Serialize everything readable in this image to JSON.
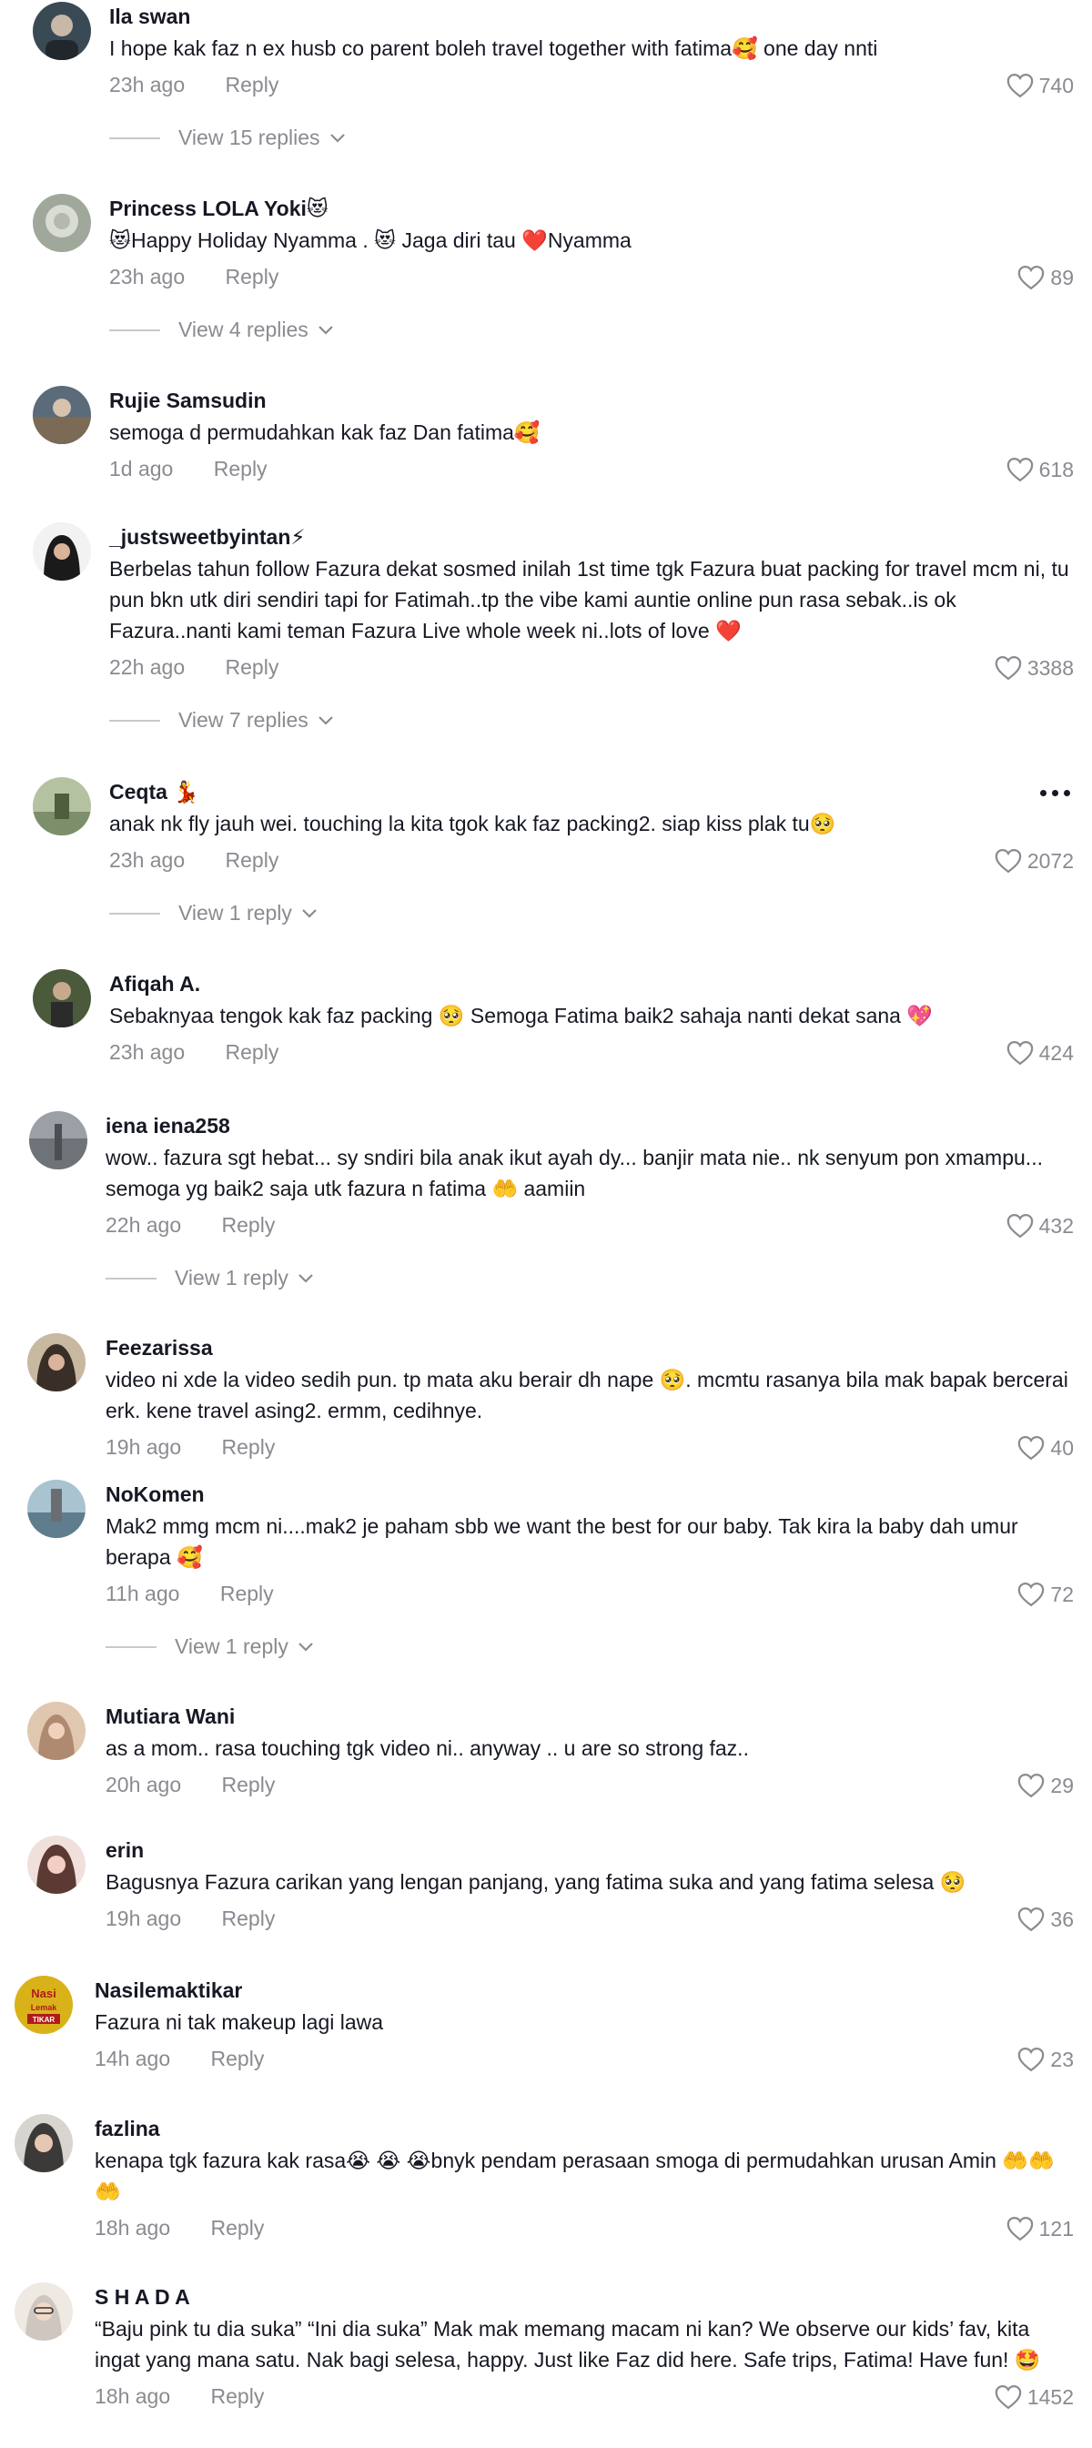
{
  "reply_label": "Reply",
  "comments": [
    {
      "username": "Ila swan",
      "text": "I hope kak faz n ex husb co parent boleh travel together with fatima🥰 one day nnti",
      "time": "23h ago",
      "likes": "740",
      "replies": "View 15 replies",
      "avatar_color": "#3a4a55"
    },
    {
      "username": "Princess LOLA Yoki😻",
      "text": "😻Happy Holiday Nyamma . 😻 Jaga diri tau ❤️Nyamma",
      "time": "23h ago",
      "likes": "89",
      "replies": "View 4 replies",
      "avatar_color": "#9fa89a"
    },
    {
      "username": "Rujie Samsudin",
      "text": "semoga d permudahkan kak faz Dan fatima🥰",
      "time": "1d ago",
      "likes": "618",
      "replies": "",
      "avatar_color": "#5b6b7a"
    },
    {
      "username": "_justsweetbyintan⚡",
      "text": "Berbelas tahun follow Fazura dekat sosmed inilah 1st time tgk Fazura buat packing for travel mcm ni, tu pun bkn utk diri sendiri tapi for Fatimah..tp the vibe kami auntie online pun rasa sebak..is ok Fazura..nanti kami teman Fazura Live whole week ni..lots of love ❤️",
      "time": "22h ago",
      "likes": "3388",
      "replies": "View 7 replies",
      "avatar_color": "#1a1a1a"
    },
    {
      "username": "Ceqta 💃",
      "text": "anak nk fly jauh wei. touching la kita tgok kak faz packing2. siap kiss plak tu🥺",
      "time": "23h ago",
      "likes": "2072",
      "replies": "View 1 reply",
      "avatar_color": "#7d8f6a"
    },
    {
      "username": "Afiqah A.",
      "text": "Sebaknyaa tengok kak faz packing 🥺 Semoga Fatima baik2 sahaja nanti dekat sana 💖",
      "time": "23h ago",
      "likes": "424",
      "replies": "",
      "avatar_color": "#4a5a3a"
    },
    {
      "username": "iena iena258",
      "text": "wow.. fazura sgt hebat... sy sndiri bila anak ikut ayah dy... banjir mata nie.. nk senyum pon xmampu... semoga yg baik2 saja utk fazura n fatima 🤲 aamiin",
      "time": "22h ago",
      "likes": "432",
      "replies": "View 1 reply",
      "avatar_color": "#6e7378"
    },
    {
      "username": "Feezarissa",
      "text": "video ni xde la video sedih pun. tp mata aku berair dh nape 🥺. mcmtu rasanya bila mak bapak bercerai erk. kene travel asing2. ermm, cedihnye.",
      "time": "19h ago",
      "likes": "40",
      "replies": "",
      "avatar_color": "#8a6e55"
    },
    {
      "username": "NoKomen",
      "text": "Mak2 mmg mcm ni....mak2 je paham sbb we want the best for our baby. Tak kira la baby dah umur berapa 🥰",
      "time": "11h ago",
      "likes": "72",
      "replies": "View 1 reply",
      "avatar_color": "#5f7d8c"
    },
    {
      "username": "Mutiara Wani",
      "text": "as a mom.. rasa touching tgk video ni.. anyway .. u are so strong faz..",
      "time": "20h ago",
      "likes": "29",
      "replies": "",
      "avatar_color": "#b08a70"
    },
    {
      "username": "erin",
      "text": "Bagusnya Fazura carikan yang lengan panjang, yang fatima suka and yang fatima selesa 🥺",
      "time": "19h ago",
      "likes": "36",
      "replies": "",
      "avatar_color": "#c89a8a"
    },
    {
      "username": "Nasilemaktikar",
      "text": "Fazura ni tak makeup lagi lawa",
      "time": "14h ago",
      "likes": "23",
      "replies": "",
      "avatar_color": "#d9b21a",
      "avatar_text": "Nasi Lemak TIKAR"
    },
    {
      "username": "fazlina",
      "text": "kenapa tgk fazura kak rasa😭 😭 😭bnyk pendam perasaan smoga di permudahkan urusan Amin 🤲🤲🤲",
      "time": "18h ago",
      "likes": "121",
      "replies": "",
      "avatar_color": "#3c3a38"
    },
    {
      "username": "S H A D A",
      "text": "“Baju pink tu dia suka” “Ini dia suka” Mak mak memang macam ni kan? We observe our kids’ fav, kita ingat yang mana satu. Nak bagi selesa, happy. Just like Faz did here. Safe trips, Fatima! Have fun! 🤩",
      "time": "18h ago",
      "likes": "1452",
      "replies": "",
      "avatar_color": "#cfc6bf"
    }
  ]
}
